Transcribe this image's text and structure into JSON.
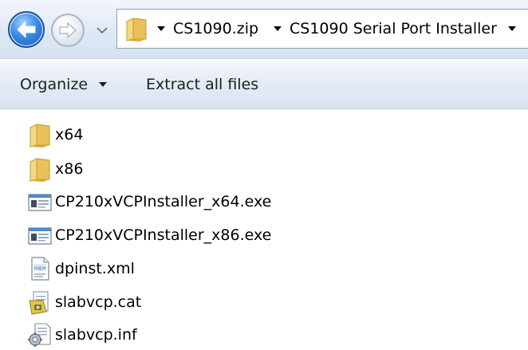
{
  "address": {
    "segments": [
      "CS1090.zip",
      "CS1090 Serial Port Installer"
    ]
  },
  "commands": {
    "organize": "Organize",
    "extract_all": "Extract all files"
  },
  "files": [
    {
      "name": "x64",
      "icon": "folder-icon"
    },
    {
      "name": "x86",
      "icon": "folder-icon"
    },
    {
      "name": "CP210xVCPInstaller_x64.exe",
      "icon": "application-icon"
    },
    {
      "name": "CP210xVCPInstaller_x86.exe",
      "icon": "application-icon"
    },
    {
      "name": "dpinst.xml",
      "icon": "xml-file-icon"
    },
    {
      "name": "slabvcp.cat",
      "icon": "security-catalog-icon"
    },
    {
      "name": "slabvcp.inf",
      "icon": "setup-information-icon"
    }
  ],
  "colors": {
    "back_button": "#2f7fdc",
    "folder": "#e8c15a",
    "toolbar": "#dfe9f5"
  }
}
